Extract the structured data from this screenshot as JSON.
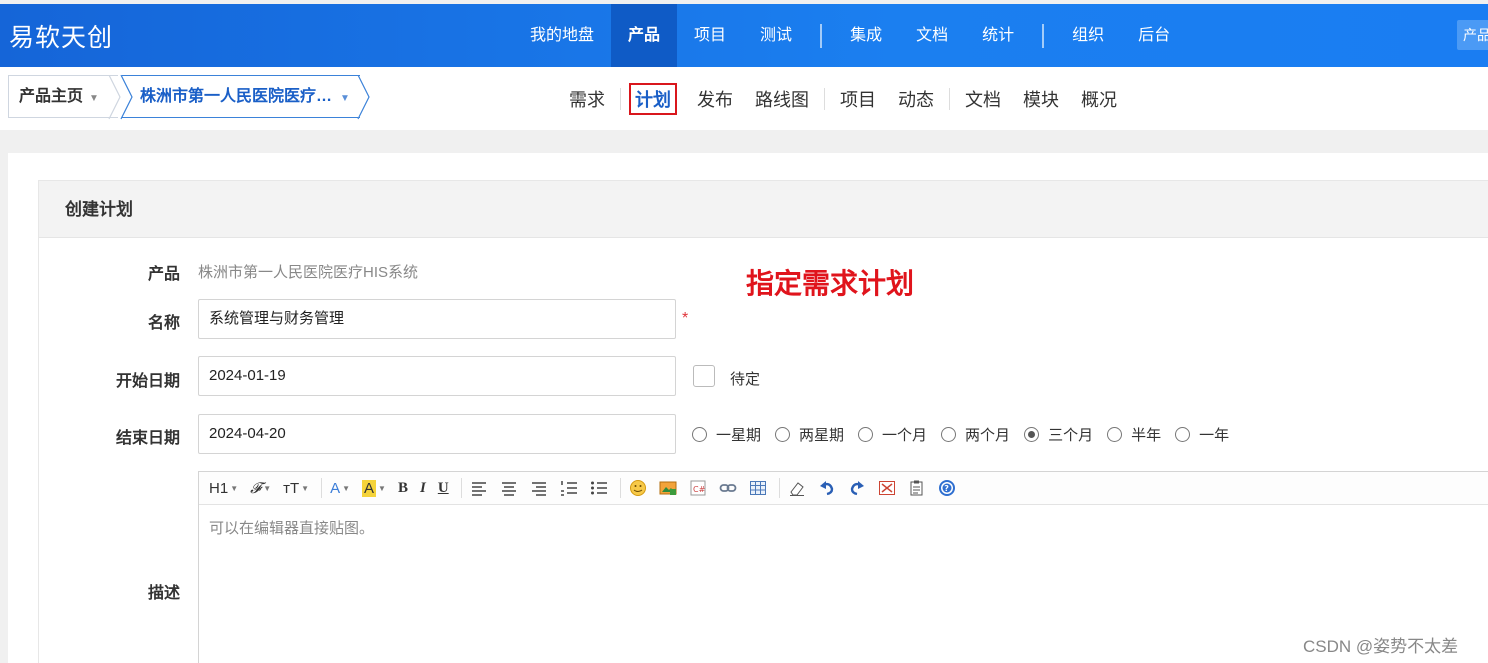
{
  "header": {
    "logo": "易软天创",
    "nav": [
      "我的地盘",
      "产品",
      "项目",
      "测试",
      "集成",
      "文档",
      "统计",
      "组织",
      "后台"
    ],
    "active": "产品",
    "right_button": "产品"
  },
  "subheader": {
    "crumb_home": "产品主页",
    "crumb_product": "株洲市第一人民医院医疗…",
    "nav": [
      "需求",
      "计划",
      "发布",
      "路线图",
      "项目",
      "动态",
      "文档",
      "模块",
      "概况"
    ],
    "active": "计划"
  },
  "form": {
    "panel_title": "创建计划",
    "product_label": "产品",
    "product_value": "株洲市第一人民医院医疗HIS系统",
    "name_label": "名称",
    "name_value": "系统管理与财务管理",
    "required_mark": "*",
    "start_label": "开始日期",
    "start_value": "2024-01-19",
    "pending_label": "待定",
    "end_label": "结束日期",
    "end_value": "2024-04-20",
    "durations": [
      "一星期",
      "两星期",
      "一个月",
      "两个月",
      "三个月",
      "半年",
      "一年"
    ],
    "selected_duration": "三个月",
    "desc_label": "描述",
    "editor_placeholder": "可以在编辑器直接贴图。",
    "toolbar": {
      "h1": "H1",
      "font": "𝓕",
      "size": "тT",
      "color": "A",
      "bg": "A",
      "bold": "B",
      "italic": "I",
      "underline": "U"
    }
  },
  "annotation": "指定需求计划",
  "watermark": "CSDN @姿势不太差",
  "colors": {
    "header_blue": "#1b7ff0",
    "active_link": "#1a5fc7",
    "annotation_red": "#e0141c"
  }
}
